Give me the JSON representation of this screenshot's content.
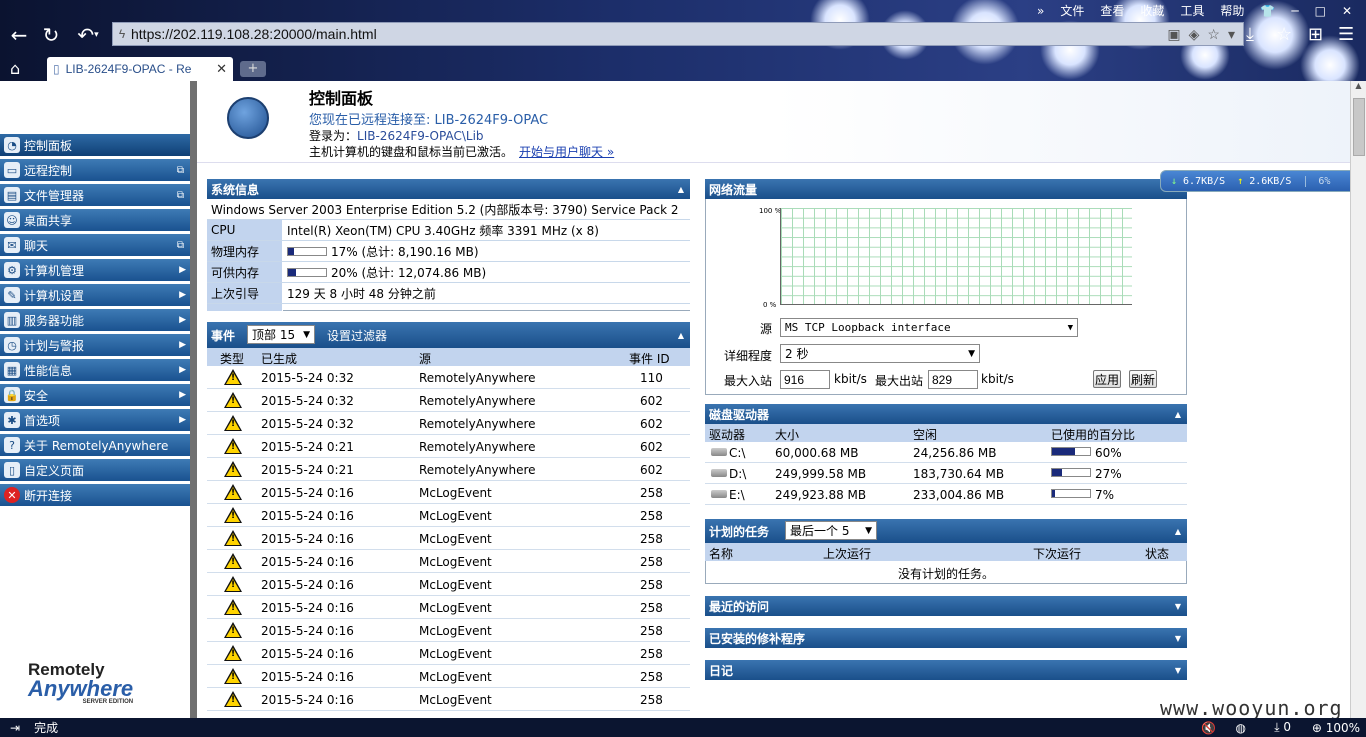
{
  "browser": {
    "menu": [
      "文件",
      "查看",
      "收藏",
      "工具",
      "帮助"
    ],
    "url": "https://202.119.108.28:20000/main.html",
    "tab_title": "LIB-2624F9-OPAC - Re",
    "status": "完成",
    "zoom": "100%",
    "downloads": "0"
  },
  "sidebar": {
    "items": [
      {
        "label": "控制面板",
        "icon": "gauge-icon"
      },
      {
        "label": "远程控制",
        "icon": "monitor-icon"
      },
      {
        "label": "文件管理器",
        "icon": "folder-icon"
      },
      {
        "label": "桌面共享",
        "icon": "users-icon"
      },
      {
        "label": "聊天",
        "icon": "chat-icon"
      },
      {
        "label": "计算机管理",
        "icon": "gear-icon"
      },
      {
        "label": "计算机设置",
        "icon": "wrench-icon"
      },
      {
        "label": "服务器功能",
        "icon": "server-icon"
      },
      {
        "label": "计划与警报",
        "icon": "clock-icon"
      },
      {
        "label": "性能信息",
        "icon": "chart-icon"
      },
      {
        "label": "安全",
        "icon": "lock-icon"
      },
      {
        "label": "首选项",
        "icon": "settings-icon"
      },
      {
        "label": "关于 RemotelyAnywhere",
        "icon": "help-icon"
      },
      {
        "label": "自定义页面",
        "icon": "page-icon"
      },
      {
        "label": "断开连接",
        "icon": "disconnect-icon"
      }
    ],
    "logo": {
      "line1": "Remotely",
      "line2": "Anywhere",
      "line3": "SERVER EDITION"
    }
  },
  "header": {
    "title": "控制面板",
    "connected": "您现在已远程连接至: LIB-2624F9-OPAC",
    "login_label": "登录为：",
    "login_user": "LIB-2624F9-OPAC\\Lib",
    "chat_text": "主机计算机的键盘和鼠标当前已激活。",
    "chat_link": "开始与用户聊天 »"
  },
  "sysinfo": {
    "title": "系统信息",
    "os": "Windows Server 2003 Enterprise Edition 5.2 (内部版本号: 3790) Service Pack 2",
    "rows": [
      {
        "key": "CPU",
        "value": "Intel(R) Xeon(TM) CPU 3.40GHz 频率 3391 MHz (x 8)"
      },
      {
        "key": "物理内存",
        "value": "17% (总计: 8,190.16 MB)",
        "pct": 0.17
      },
      {
        "key": "可供内存",
        "value": "20% (总计: 12,074.86 MB)",
        "pct": 0.2
      },
      {
        "key": "上次引导",
        "value": "129 天 8 小时 48 分钟之前"
      }
    ]
  },
  "events": {
    "title": "事件",
    "filter_select": "顶部  15",
    "filter_link": "设置过滤器",
    "columns": [
      "类型",
      "已生成",
      "源",
      "事件 ID"
    ],
    "rows": [
      {
        "time": "2015-5-24 0:32",
        "source": "RemotelyAnywhere",
        "id": "110"
      },
      {
        "time": "2015-5-24 0:32",
        "source": "RemotelyAnywhere",
        "id": "602"
      },
      {
        "time": "2015-5-24 0:32",
        "source": "RemotelyAnywhere",
        "id": "602"
      },
      {
        "time": "2015-5-24 0:21",
        "source": "RemotelyAnywhere",
        "id": "602"
      },
      {
        "time": "2015-5-24 0:21",
        "source": "RemotelyAnywhere",
        "id": "602"
      },
      {
        "time": "2015-5-24 0:16",
        "source": "McLogEvent",
        "id": "258"
      },
      {
        "time": "2015-5-24 0:16",
        "source": "McLogEvent",
        "id": "258"
      },
      {
        "time": "2015-5-24 0:16",
        "source": "McLogEvent",
        "id": "258"
      },
      {
        "time": "2015-5-24 0:16",
        "source": "McLogEvent",
        "id": "258"
      },
      {
        "time": "2015-5-24 0:16",
        "source": "McLogEvent",
        "id": "258"
      },
      {
        "time": "2015-5-24 0:16",
        "source": "McLogEvent",
        "id": "258"
      },
      {
        "time": "2015-5-24 0:16",
        "source": "McLogEvent",
        "id": "258"
      },
      {
        "time": "2015-5-24 0:16",
        "source": "McLogEvent",
        "id": "258"
      },
      {
        "time": "2015-5-24 0:16",
        "source": "McLogEvent",
        "id": "258"
      },
      {
        "time": "2015-5-24 0:16",
        "source": "McLogEvent",
        "id": "258"
      }
    ]
  },
  "network": {
    "title": "网络流量",
    "y_top": "100 %",
    "y_bottom": "0 %",
    "source_label": "源",
    "source_value": "MS TCP Loopback interface",
    "detail_label": "详细程度",
    "detail_value": "2 秒",
    "max_in_label": "最大入站",
    "max_in_value": "916",
    "max_out_label": "最大出站",
    "max_out_value": "829",
    "unit": "kbit/s",
    "apply": "应用",
    "refresh": "刷新"
  },
  "disks": {
    "title": "磁盘驱动器",
    "columns": [
      "驱动器",
      "大小",
      "空闲",
      "已使用的百分比"
    ],
    "rows": [
      {
        "drive": "C:\\",
        "size": "60,000.68 MB",
        "free": "24,256.86 MB",
        "pct_label": "60%",
        "pct": 0.6
      },
      {
        "drive": "D:\\",
        "size": "249,999.58 MB",
        "free": "183,730.64 MB",
        "pct_label": "27%",
        "pct": 0.27
      },
      {
        "drive": "E:\\",
        "size": "249,923.88 MB",
        "free": "233,004.86 MB",
        "pct_label": "7%",
        "pct": 0.07
      }
    ]
  },
  "tasks": {
    "title": "计划的任务",
    "select": "最后一个  5",
    "columns": [
      "名称",
      "上次运行",
      "下次运行",
      "状态"
    ],
    "empty": "没有计划的任务。"
  },
  "collapsed": {
    "recent": "最近的访问",
    "patches": "已安装的修补程序",
    "log": "日记"
  },
  "speed": {
    "down": "6.7KB/S",
    "up": "2.6KB/S",
    "cpu": "6%"
  },
  "watermark": "www.wooyun.org"
}
